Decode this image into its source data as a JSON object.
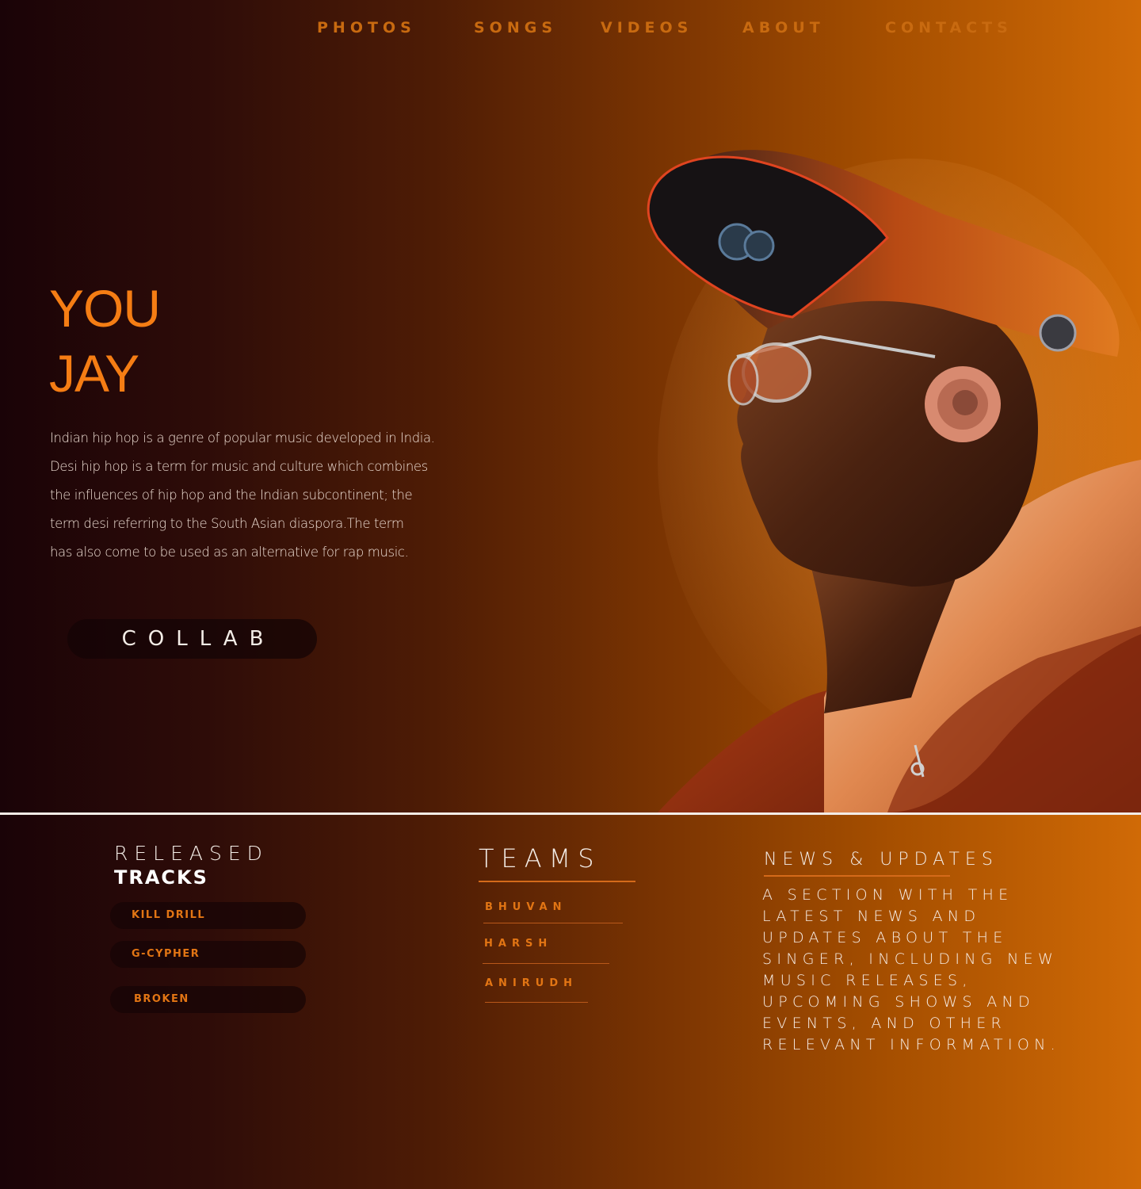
{
  "nav": {
    "items": [
      "PHOTOS",
      "SONGS",
      "VIDEOS",
      "ABOUT",
      "CONTACTS"
    ]
  },
  "hero": {
    "title_line1": "YOU",
    "title_line2": "JAY",
    "description_lines": [
      "Indian hip hop is a genre of popular music developed in India.",
      "Desi hip hop is a term for music and culture which combines",
      "the influences of hip hop and the Indian subcontinent; the",
      "term desi referring to the South Asian diaspora.The term",
      "has also come to be used as an alternative for rap music."
    ],
    "cta_label": "COLLAB"
  },
  "released": {
    "title": "RELEASED",
    "subtitle": "TRACKS",
    "tracks": [
      "KILL DRILL",
      "G-CYPHER",
      "BROKEN"
    ]
  },
  "teams": {
    "title": "TEAMS",
    "members": [
      "BHUVAN",
      "HARSH",
      "ANIRUDH"
    ]
  },
  "news": {
    "title": "NEWS & UPDATES",
    "body_lines": [
      "A SECTION WITH THE",
      "LATEST NEWS AND",
      "UPDATES ABOUT THE",
      "SINGER, INCLUDING NEW",
      "MUSIC RELEASES,",
      "UPCOMING SHOWS AND",
      "EVENTS, AND OTHER",
      "RELEVANT INFORMATION."
    ]
  },
  "colors": {
    "accent": "#f57d14",
    "nav_text": "#c86a10",
    "background_dark": "#1a0307",
    "background_orange": "#d06a06"
  }
}
